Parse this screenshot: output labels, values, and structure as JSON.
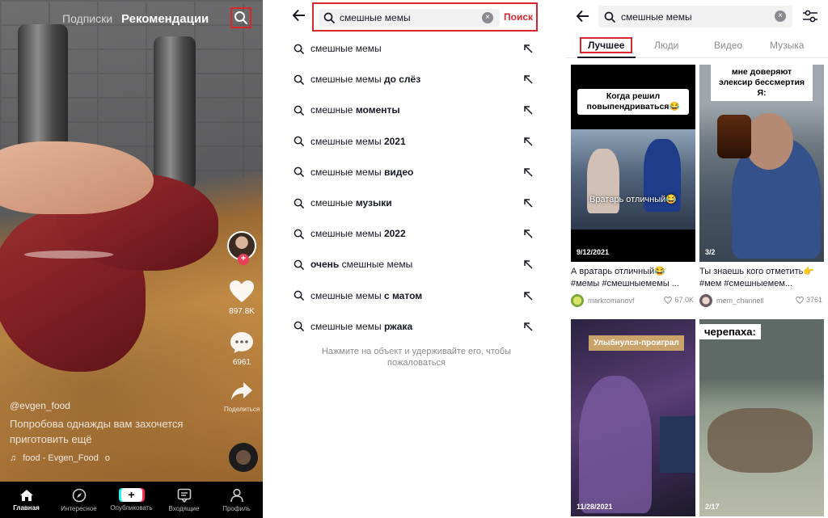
{
  "panel1": {
    "top_tabs": {
      "following": "Подписки",
      "for_you": "Рекомендации"
    },
    "likes": "897.8K",
    "comments": "6961",
    "share_label": "Поделиться",
    "username": "@evgen_food",
    "description": "Попробова однажды вам захочется приготовить ещё",
    "music": "food - Evgen_Food",
    "music_suffix": "o",
    "nav": {
      "home": "Главная",
      "discover": "Интересное",
      "publish": "Опубликовать",
      "inbox": "Входящие",
      "profile": "Профиль"
    }
  },
  "panel2": {
    "query": "смешные мемы",
    "search_button": "Поиск",
    "suggestions": [
      {
        "base": "смешные мемы",
        "bold": ""
      },
      {
        "base": "смешные мемы ",
        "bold": "до слёз"
      },
      {
        "base": "смешные ",
        "bold": "моменты"
      },
      {
        "base": "смешные мемы ",
        "bold": "2021"
      },
      {
        "base": "смешные мемы ",
        "bold": "видео"
      },
      {
        "base": "смешные ",
        "bold": "музыки"
      },
      {
        "base": "смешные мемы ",
        "bold": "2022"
      },
      {
        "prefix_bold": "очень",
        "base": " смешные мемы",
        "bold": ""
      },
      {
        "base": "смешные мемы ",
        "bold": "с матом"
      },
      {
        "base": "смешные мемы ",
        "bold": "ржака"
      }
    ],
    "hint": "Нажмите на объект и удерживайте его, чтобы пожаловаться"
  },
  "panel3": {
    "query": "смешные мемы",
    "tabs": [
      "Лучшее",
      "Люди",
      "Видео",
      "Музыка"
    ],
    "cards": [
      {
        "caption": "Когда решил повыпендриваться😂",
        "inner_caption": "Вратарь отличный😂",
        "date": "9/12/2021",
        "title": "А вратарь отличный😂 #мемы #смешныемемы ...",
        "author": "markromanovf",
        "likes": "67.0K"
      },
      {
        "caption": "мне доверяют элексир бессмертия Я:",
        "date": "3/2",
        "title": "Ты знаешь кого отметить👉 #мем #смешныемем...",
        "author": "mem_channell",
        "likes": "3761"
      },
      {
        "caption": "Улыбнулся-проиграл",
        "date": "11/28/2021"
      },
      {
        "caption": "черепаха:",
        "date": "2/17"
      }
    ]
  }
}
